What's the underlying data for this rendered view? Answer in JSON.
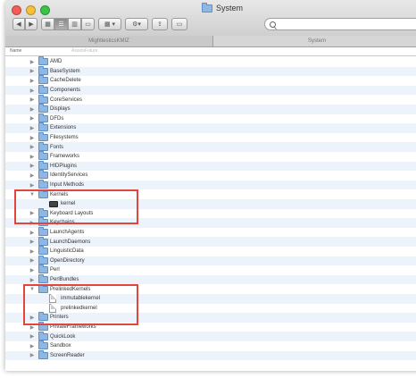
{
  "window": {
    "title": "System"
  },
  "tabs": [
    {
      "label": "MightiesticsKMIZ"
    },
    {
      "label": "System"
    }
  ],
  "search": {
    "placeholder": ""
  },
  "columns": {
    "name_header": "Name",
    "ghost_text": "AssetsFuture"
  },
  "rows": [
    {
      "label": "AMD",
      "type": "folder",
      "depth": 0,
      "expanded": false
    },
    {
      "label": "BaseSystem",
      "type": "folder",
      "depth": 0,
      "expanded": false
    },
    {
      "label": "CacheDelete",
      "type": "folder",
      "depth": 0,
      "expanded": false
    },
    {
      "label": "Components",
      "type": "folder",
      "depth": 0,
      "expanded": false
    },
    {
      "label": "CoreServices",
      "type": "folder",
      "depth": 0,
      "expanded": false
    },
    {
      "label": "Displays",
      "type": "folder",
      "depth": 0,
      "expanded": false
    },
    {
      "label": "DFDs",
      "type": "folder",
      "depth": 0,
      "expanded": false
    },
    {
      "label": "Extensions",
      "type": "folder",
      "depth": 0,
      "expanded": false
    },
    {
      "label": "Filesystems",
      "type": "folder",
      "depth": 0,
      "expanded": false
    },
    {
      "label": "Fonts",
      "type": "folder",
      "depth": 0,
      "expanded": false
    },
    {
      "label": "Frameworks",
      "type": "folder",
      "depth": 0,
      "expanded": false
    },
    {
      "label": "HIDPlugins",
      "type": "folder",
      "depth": 0,
      "expanded": false
    },
    {
      "label": "IdentityServices",
      "type": "folder",
      "depth": 0,
      "expanded": false
    },
    {
      "label": "Input Methods",
      "type": "folder",
      "depth": 0,
      "expanded": false
    },
    {
      "label": "Kernels",
      "type": "folder",
      "depth": 0,
      "expanded": true
    },
    {
      "label": "kernel",
      "type": "kernel",
      "depth": 1,
      "expanded": false
    },
    {
      "label": "Keyboard Layouts",
      "type": "folder",
      "depth": 0,
      "expanded": false
    },
    {
      "label": "Keychains",
      "type": "folder",
      "depth": 0,
      "expanded": false
    },
    {
      "label": "LaunchAgents",
      "type": "folder",
      "depth": 0,
      "expanded": false
    },
    {
      "label": "LaunchDaemons",
      "type": "folder",
      "depth": 0,
      "expanded": false
    },
    {
      "label": "LinguisticData",
      "type": "folder",
      "depth": 0,
      "expanded": false
    },
    {
      "label": "OpenDirectory",
      "type": "folder",
      "depth": 0,
      "expanded": false
    },
    {
      "label": "Perl",
      "type": "folder",
      "depth": 0,
      "expanded": false
    },
    {
      "label": "PerlBundles",
      "type": "folder",
      "depth": 0,
      "expanded": false
    },
    {
      "label": "PrelinkedKernels",
      "type": "folder",
      "depth": 0,
      "expanded": true
    },
    {
      "label": "immutablekernel",
      "type": "doc",
      "depth": 1,
      "expanded": false
    },
    {
      "label": "prelinkedkernel",
      "type": "doc",
      "depth": 1,
      "expanded": false
    },
    {
      "label": "Printers",
      "type": "folder",
      "depth": 0,
      "expanded": false
    },
    {
      "label": "PrivateFrameworks",
      "type": "folder",
      "depth": 0,
      "expanded": false
    },
    {
      "label": "QuickLook",
      "type": "folder",
      "depth": 0,
      "expanded": false
    },
    {
      "label": "Sandbox",
      "type": "folder",
      "depth": 0,
      "expanded": false
    },
    {
      "label": "ScreenReader",
      "type": "folder",
      "depth": 0,
      "expanded": false
    }
  ],
  "highlight_color": "#e2453b"
}
